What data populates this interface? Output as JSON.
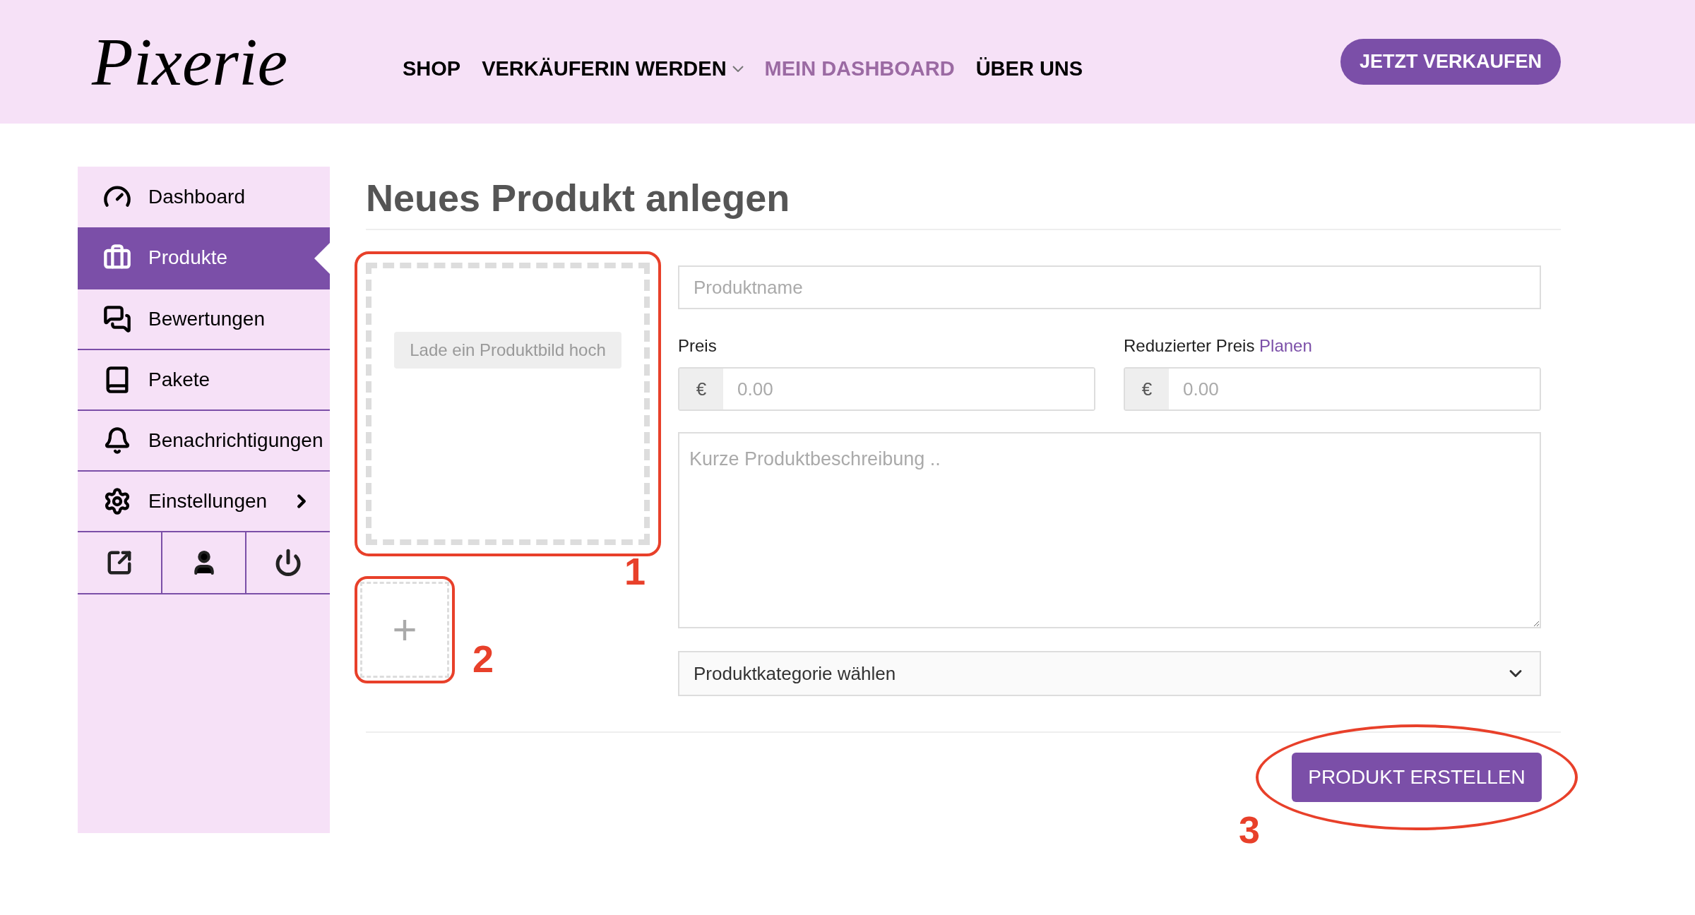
{
  "header": {
    "logo": "Pixerie",
    "nav": [
      {
        "label": "SHOP",
        "selected": false,
        "has_dropdown": false
      },
      {
        "label": "VERKÄUFERIN WERDEN",
        "selected": false,
        "has_dropdown": true
      },
      {
        "label": "MEIN DASHBOARD",
        "selected": true,
        "has_dropdown": false
      },
      {
        "label": "ÜBER UNS",
        "selected": false,
        "has_dropdown": false
      }
    ],
    "cta": "JETZT VERKAUFEN"
  },
  "sidebar": {
    "items": [
      {
        "label": "Dashboard",
        "selected": false,
        "has_submenu": false
      },
      {
        "label": "Produkte",
        "selected": true,
        "has_submenu": false
      },
      {
        "label": "Bewertungen",
        "selected": false,
        "has_submenu": false
      },
      {
        "label": "Pakete",
        "selected": false,
        "has_submenu": false
      },
      {
        "label": "Benachrichtigungen",
        "selected": false,
        "has_submenu": false
      },
      {
        "label": "Einstellungen",
        "selected": false,
        "has_submenu": true
      }
    ]
  },
  "page": {
    "title": "Neues Produkt anlegen",
    "upload_button": "Lade ein Produktbild hoch",
    "add_image": "+",
    "name_placeholder": "Produktname",
    "price": {
      "label": "Preis",
      "currency": "€",
      "placeholder": "0.00"
    },
    "sale_price": {
      "label": "Reduzierter Preis",
      "link": "Planen",
      "currency": "€",
      "placeholder": "0.00"
    },
    "description_placeholder": "Kurze Produktbeschreibung ..",
    "category": "Produktkategorie wählen",
    "submit": "PRODUKT ERSTELLEN"
  },
  "annotations": [
    "1",
    "2",
    "3"
  ]
}
